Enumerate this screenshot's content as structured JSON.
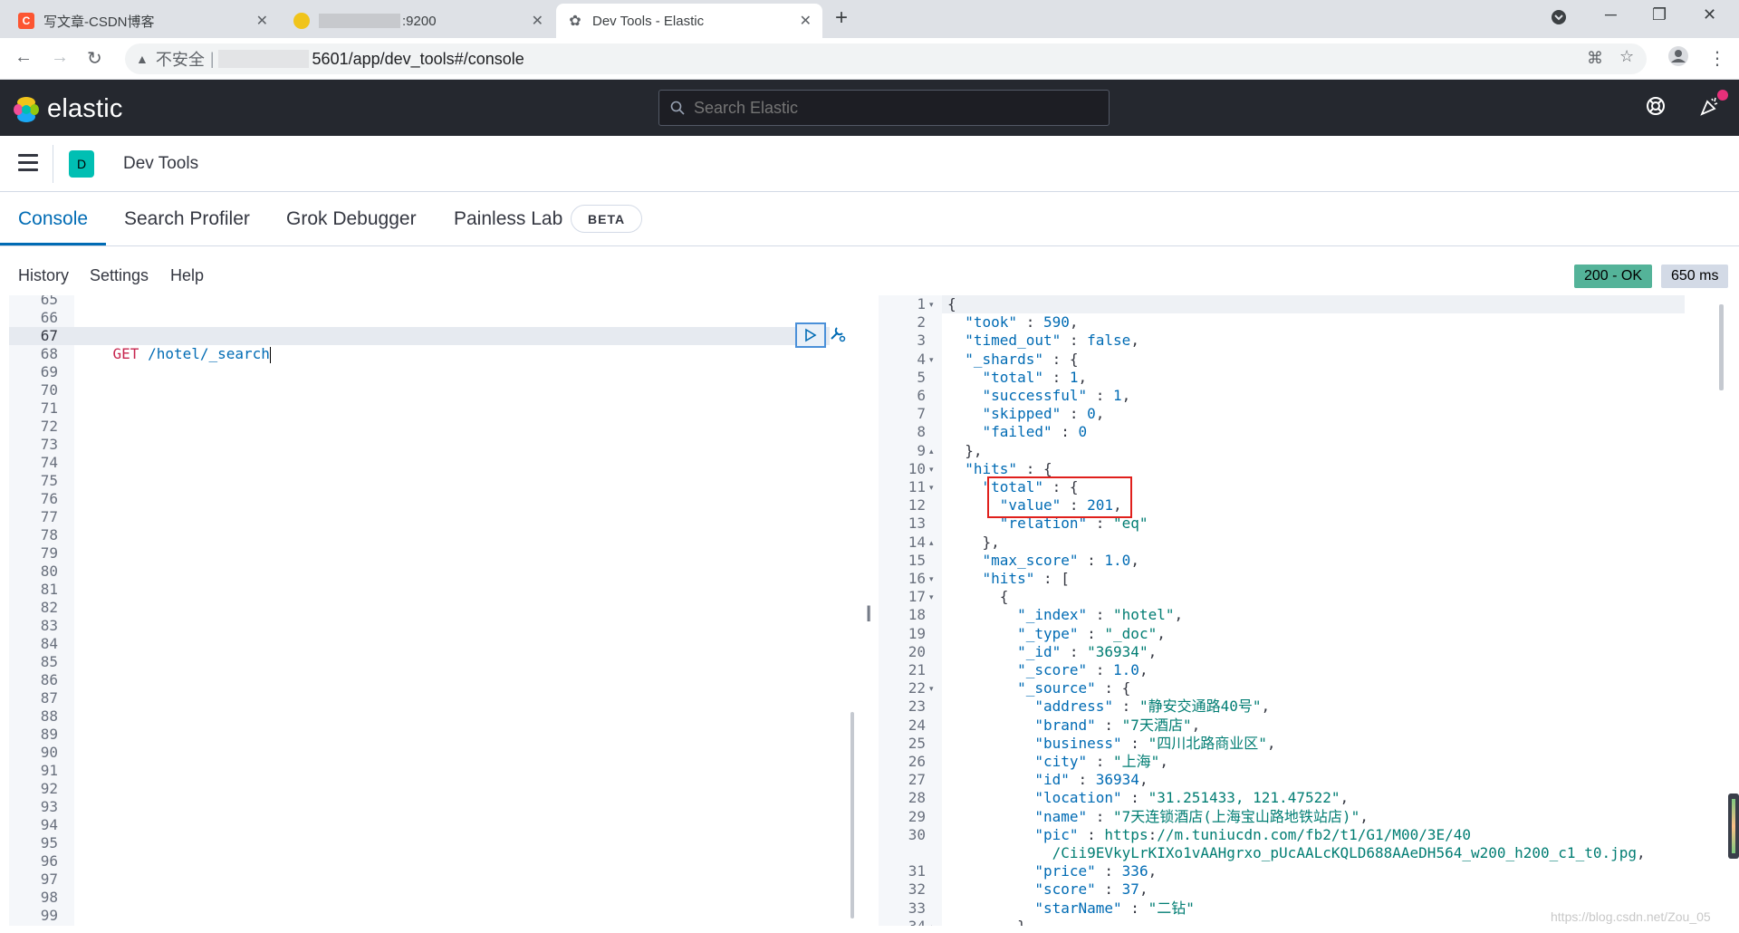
{
  "browser": {
    "tabs": [
      {
        "title": "写文章-CSDN博客",
        "favicon": "csdn-logo",
        "favicon_color": "#fc5531"
      },
      {
        "title": ":9200",
        "favicon": "elastic-logo",
        "blurred_prefix": true
      },
      {
        "title": "Dev Tools - Elastic",
        "favicon": "kibana-logo",
        "active": true
      }
    ],
    "address": {
      "security_label": "不安全",
      "url_suffix": "5601/app/dev_tools#/console"
    }
  },
  "header": {
    "brand": "elastic",
    "search_placeholder": "Search Elastic"
  },
  "breadcrumb": {
    "space_initial": "D",
    "page": "Dev Tools"
  },
  "devtools_tabs": [
    "Console",
    "Search Profiler",
    "Grok Debugger",
    "Painless Lab"
  ],
  "beta_label": "BETA",
  "toolbar": {
    "history": "History",
    "settings": "Settings",
    "help": "Help",
    "status": "200 - OK",
    "status_color": "#54b399",
    "time": "650 ms"
  },
  "request_editor": {
    "first_line_number": 65,
    "line_numbers": [
      "65",
      "66",
      "67",
      "68",
      "69",
      "70",
      "71",
      "72",
      "73",
      "74",
      "75",
      "76",
      "77",
      "78",
      "79",
      "80",
      "81",
      "82",
      "83",
      "84",
      "85",
      "86",
      "87",
      "88",
      "89",
      "90",
      "91",
      "92",
      "93",
      "94",
      "95",
      "96",
      "97",
      "98",
      "99"
    ],
    "active_line": "67",
    "method": "GET",
    "path": " /hotel/_search"
  },
  "response_editor": {
    "lines": [
      {
        "n": "1",
        "fold": "▾",
        "text": "{"
      },
      {
        "n": "2",
        "text": "  \"took\" : 590,"
      },
      {
        "n": "3",
        "text": "  \"timed_out\" : false,"
      },
      {
        "n": "4",
        "fold": "▾",
        "text": "  \"_shards\" : {"
      },
      {
        "n": "5",
        "text": "    \"total\" : 1,"
      },
      {
        "n": "6",
        "text": "    \"successful\" : 1,"
      },
      {
        "n": "7",
        "text": "    \"skipped\" : 0,"
      },
      {
        "n": "8",
        "text": "    \"failed\" : 0"
      },
      {
        "n": "9",
        "fold": "▴",
        "text": "  },"
      },
      {
        "n": "10",
        "fold": "▾",
        "text": "  \"hits\" : {"
      },
      {
        "n": "11",
        "fold": "▾",
        "text": "    \"total\" : {"
      },
      {
        "n": "12",
        "text": "      \"value\" : 201,"
      },
      {
        "n": "13",
        "text": "      \"relation\" : \"eq\""
      },
      {
        "n": "14",
        "fold": "▴",
        "text": "    },"
      },
      {
        "n": "15",
        "text": "    \"max_score\" : 1.0,"
      },
      {
        "n": "16",
        "fold": "▾",
        "text": "    \"hits\" : ["
      },
      {
        "n": "17",
        "fold": "▾",
        "text": "      {"
      },
      {
        "n": "18",
        "text": "        \"_index\" : \"hotel\","
      },
      {
        "n": "19",
        "text": "        \"_type\" : \"_doc\","
      },
      {
        "n": "20",
        "text": "        \"_id\" : \"36934\","
      },
      {
        "n": "21",
        "text": "        \"_score\" : 1.0,"
      },
      {
        "n": "22",
        "fold": "▾",
        "text": "        \"_source\" : {"
      },
      {
        "n": "23",
        "text": "          \"address\" : \"静安交通路40号\","
      },
      {
        "n": "24",
        "text": "          \"brand\" : \"7天酒店\","
      },
      {
        "n": "25",
        "text": "          \"business\" : \"四川北路商业区\","
      },
      {
        "n": "26",
        "text": "          \"city\" : \"上海\","
      },
      {
        "n": "27",
        "text": "          \"id\" : 36934,"
      },
      {
        "n": "28",
        "text": "          \"location\" : \"31.251433, 121.47522\","
      },
      {
        "n": "29",
        "text": "          \"name\" : \"7天连锁酒店(上海宝山路地铁站店)\","
      },
      {
        "n": "30",
        "text": "          \"pic\" : \"https://m.tuniucdn.com/fb2/t1/G1/M00/3E/40"
      },
      {
        "n": "",
        "text": "            /Cii9EVkyLrKIXo1vAAHgrxo_pUcAALcKQLD688AAeDH564_w200_h200_c1_t0.jpg\","
      },
      {
        "n": "31",
        "text": "          \"price\" : 336,"
      },
      {
        "n": "32",
        "text": "          \"score\" : 37,"
      },
      {
        "n": "33",
        "text": "          \"starName\" : \"二钻\""
      },
      {
        "n": "34",
        "fold": "▴",
        "text": "        }"
      }
    ]
  },
  "watermark": "https://blog.csdn.net/Zou_05"
}
